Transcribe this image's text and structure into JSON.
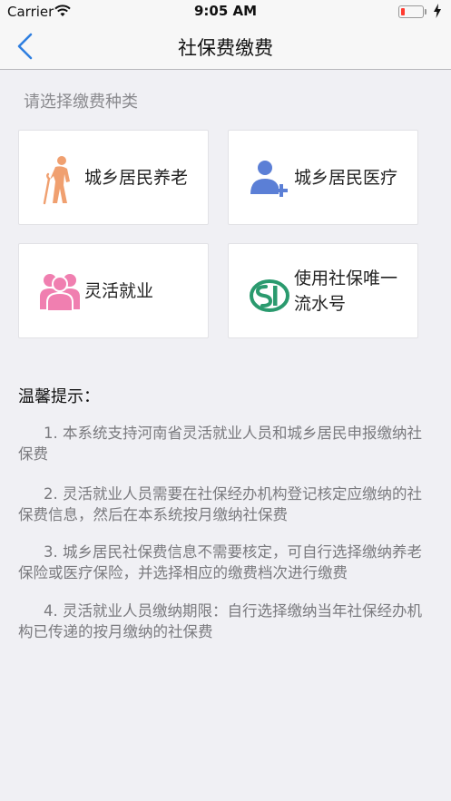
{
  "status_bar": {
    "carrier": "Carrier",
    "time": "9:05 AM"
  },
  "nav": {
    "title": "社保费缴费"
  },
  "section_label": "请选择缴费种类",
  "options": [
    {
      "label": "城乡居民养老",
      "icon": "elderly-person-icon",
      "color": "#f0a070"
    },
    {
      "label": "城乡居民医疗",
      "icon": "user-add-icon",
      "color": "#5b7fd6"
    },
    {
      "label": "灵活就业",
      "icon": "people-icon",
      "color": "#f07fb0"
    },
    {
      "label": "使用社保唯一流水号",
      "icon": "social-security-logo-icon",
      "color": "#2a9a6e"
    }
  ],
  "tips": {
    "title": "温馨提示：",
    "items": [
      "1. 本系统支持河南省灵活就业人员和城乡居民申报缴纳社保费",
      "2. 灵活就业人员需要在社保经办机构登记核定应缴纳的社保费信息，然后在本系统按月缴纳社保费",
      "3. 城乡居民社保费信息不需要核定，可自行选择缴纳养老保险或医疗保险，并选择相应的缴费档次进行缴费",
      "4. 灵活就业人员缴纳期限：自行选择缴纳当年社保经办机构已传递的按月缴纳的社保费"
    ]
  }
}
